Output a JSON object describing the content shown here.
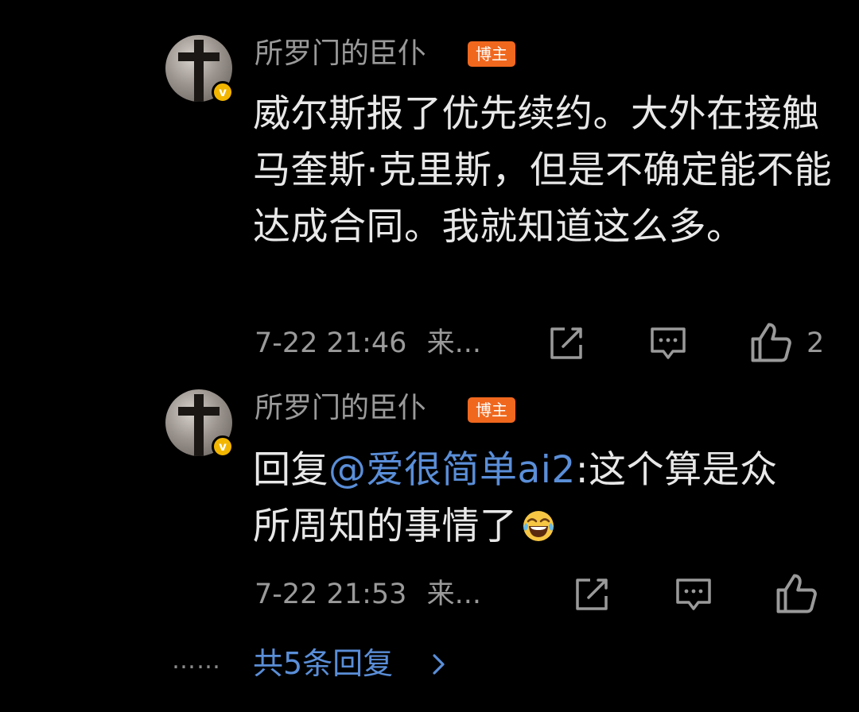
{
  "comments": [
    {
      "username": "所罗门的臣仆",
      "tag": "博主",
      "verified_badge": "v",
      "text": "威尔斯报了优先续约。大外在接触马奎斯·克里斯，但是不确定能不能达成合同。我就知道这么多。",
      "time": "7-22 21:46",
      "source": "来...",
      "like_count": "2"
    },
    {
      "username": "所罗门的臣仆",
      "tag": "博主",
      "verified_badge": "v",
      "reply_prefix": "回复",
      "mention": "@爱很简单ai2",
      "reply_text": ":这个算是众所周知的事情了",
      "emoji": "laughing-tears-emoji",
      "time": "7-22 21:53",
      "source": "来..."
    }
  ],
  "more_replies": {
    "dots": "……",
    "label": "共5条回复"
  },
  "colors": {
    "background": "#000000",
    "tag": "#f0681e",
    "link": "#5a8ed8",
    "verified": "#f2b600"
  }
}
